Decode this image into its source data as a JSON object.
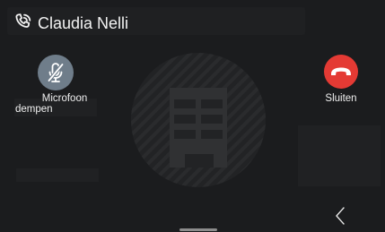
{
  "call": {
    "caller_name": "Claudia Nelli",
    "status_icon": "phone-ringing-icon",
    "avatar_icon": "building-icon"
  },
  "controls": {
    "mute_label_line1": "Microfoon",
    "mute_label_line2": "dempen",
    "mute_icon": "microphone-off-icon",
    "hangup_label": "Sluiten",
    "hangup_icon": "phone-hangup-icon"
  },
  "navigation": {
    "back_icon": "chevron-left-icon"
  },
  "colors": {
    "background": "#1b1c1e",
    "mute_button": "#6f7d8a",
    "hangup_button": "#e43a34",
    "text": "#f0f0f0"
  }
}
